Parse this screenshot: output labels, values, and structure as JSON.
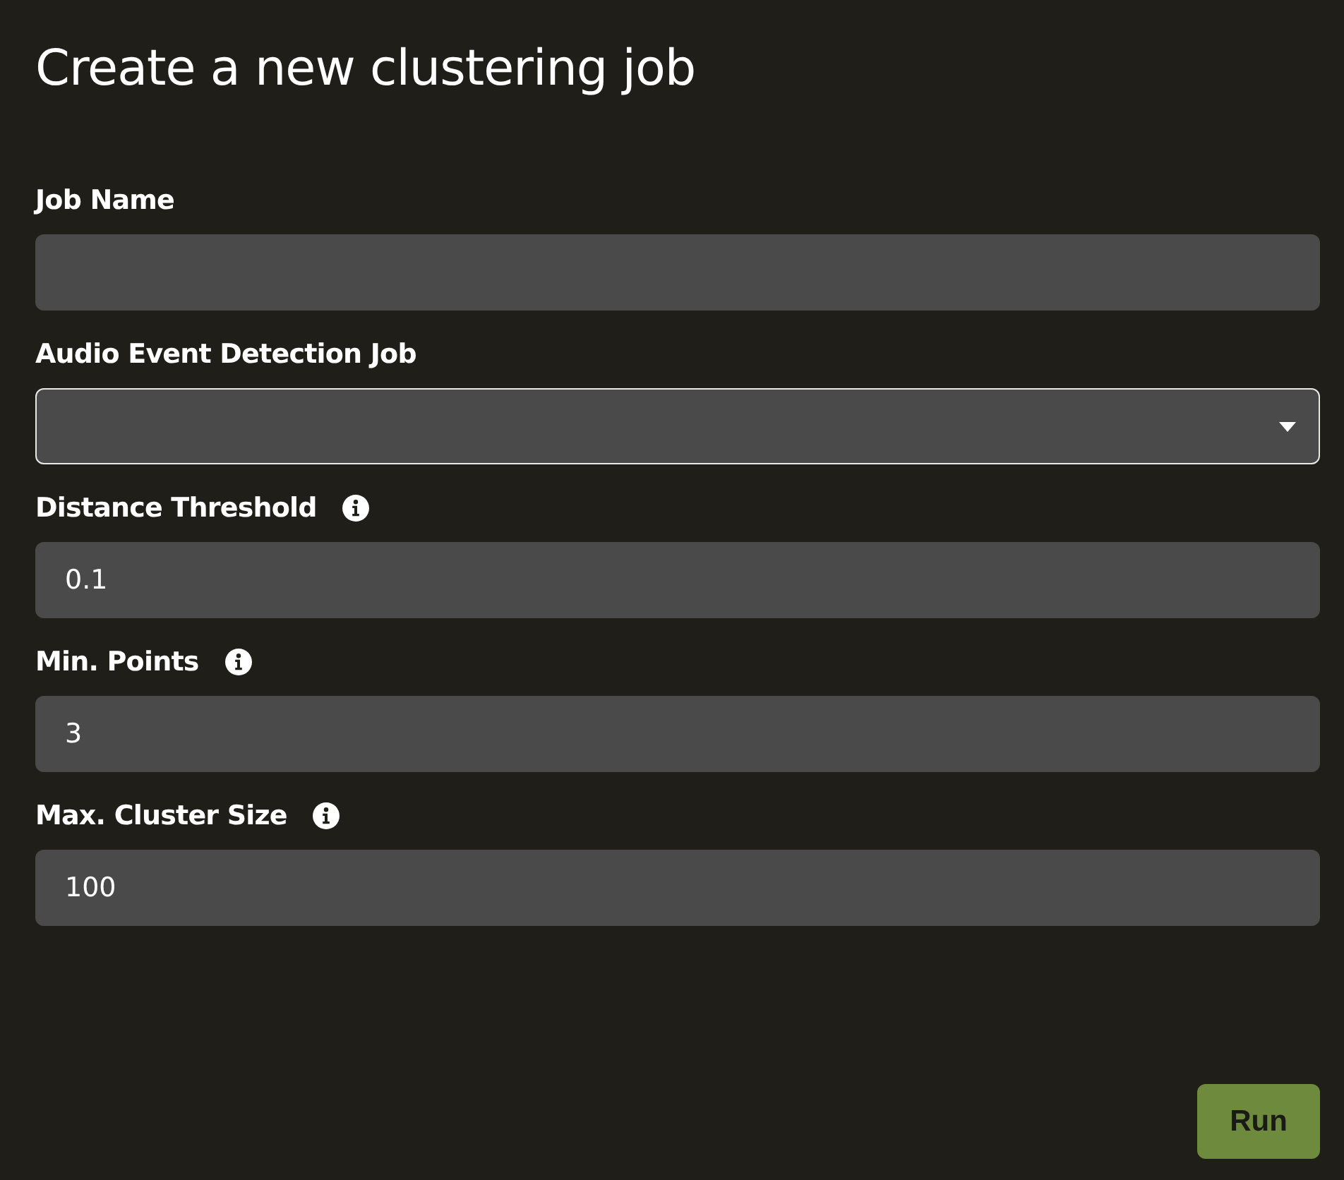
{
  "title": "Create a new clustering job",
  "fields": [
    {
      "kind": "text",
      "label": "Job Name",
      "info": false,
      "focused": false
    },
    {
      "kind": "select",
      "label": "Audio Event Detection Job",
      "info": false,
      "focused": true
    },
    {
      "kind": "text",
      "label": "Distance Threshold",
      "info": true,
      "focused": false,
      "value": "0.1"
    },
    {
      "kind": "text",
      "label": "Min. Points",
      "info": true,
      "focused": false,
      "value": "3"
    },
    {
      "kind": "text",
      "label": "Max. Cluster Size",
      "info": true,
      "focused": false,
      "value": "100"
    }
  ],
  "button": "Run"
}
